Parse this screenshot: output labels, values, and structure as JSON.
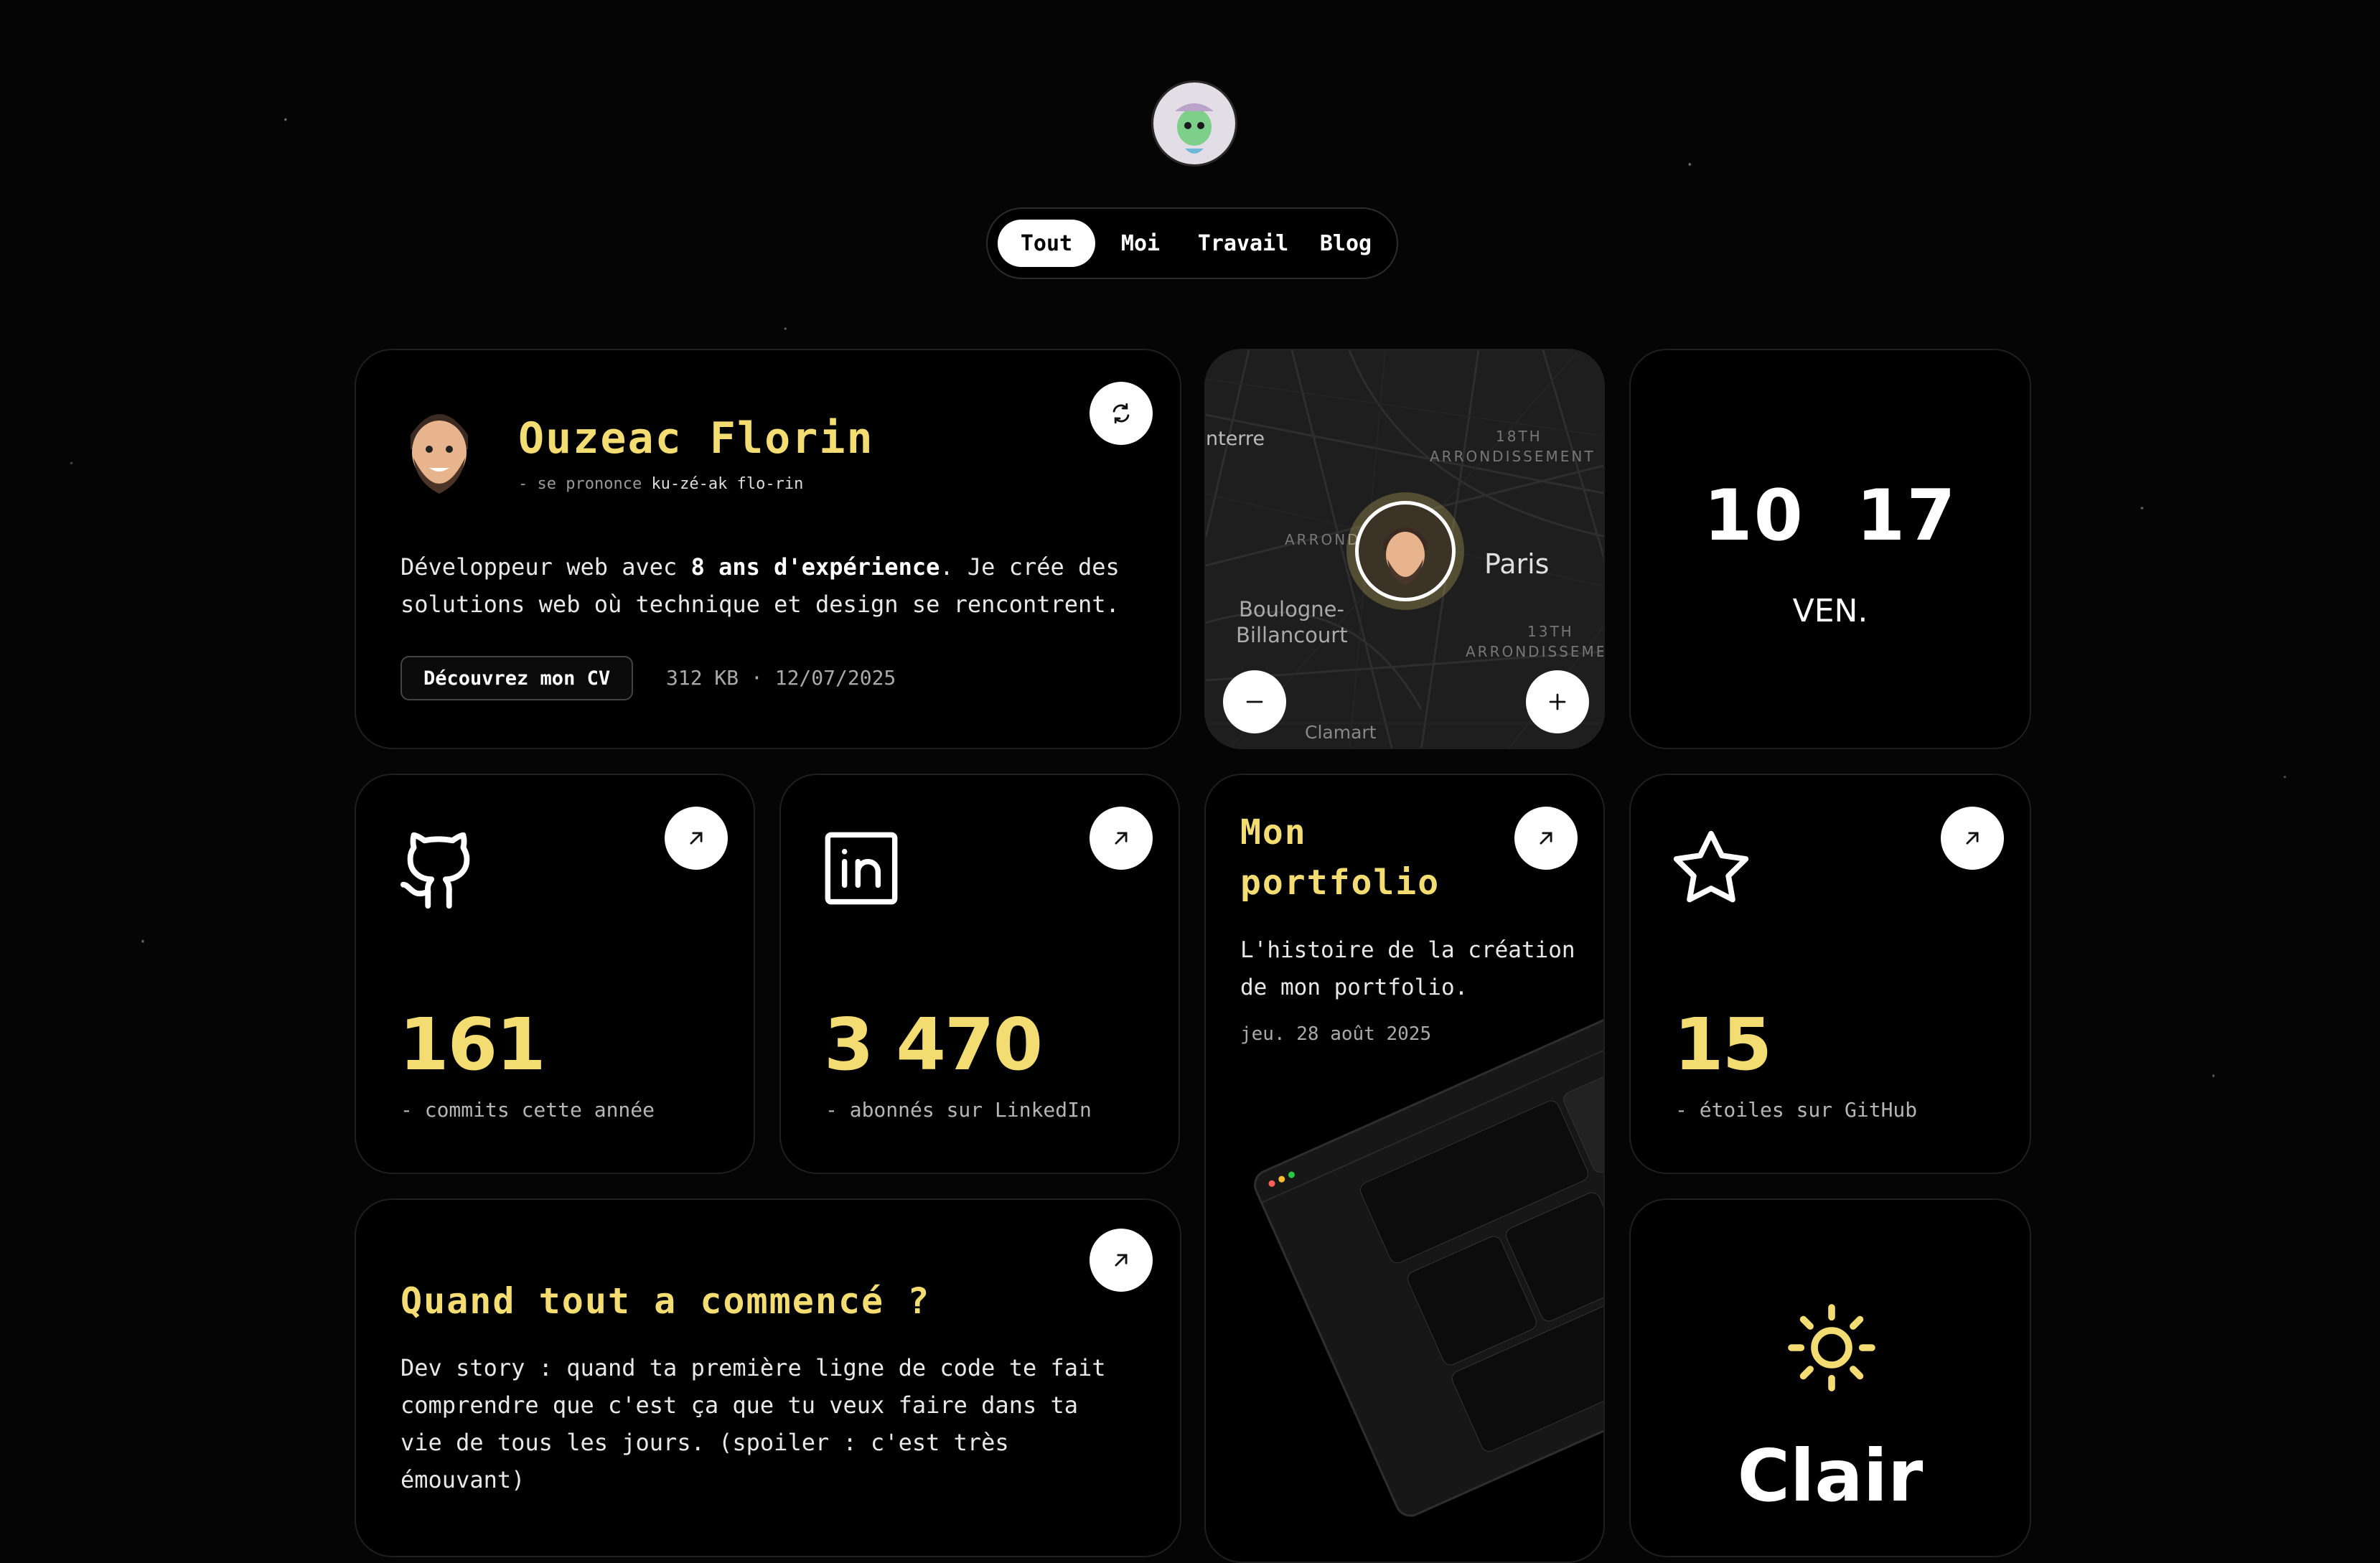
{
  "nav": {
    "tabs": [
      "Tout",
      "Moi",
      "Travail",
      "Blog"
    ],
    "active": "Tout"
  },
  "profile": {
    "name": "Ouzeac Florin",
    "pronounce_prefix": "- se prononce",
    "pronounce": "ku-zé-ak flo-rin",
    "bio_1": "Développeur web avec ",
    "bio_bold": "8 ans d'expérience",
    "bio_2": ". Je crée des solutions web où technique et design se rencontrent.",
    "cv_button": "Découvrez mon CV",
    "cv_meta": "312 KB · 12/07/2025"
  },
  "map": {
    "labels": [
      "nterre",
      "18TH",
      "ARRONDISSEMENT",
      "ARRONDISSEMENT",
      "Paris",
      "Boulogne-",
      "Billancourt",
      "13TH",
      "ARRONDISSEME",
      "Clamart"
    ]
  },
  "clock": {
    "hours": "10",
    "minutes": "17",
    "day": "VEN."
  },
  "github": {
    "value": "161",
    "caption": "- commits cette année"
  },
  "linkedin": {
    "value": "3 470",
    "caption": "- abonnés sur LinkedIn"
  },
  "portfolio": {
    "title_1": "Mon",
    "title_2": "portfolio",
    "text": "L'histoire de la création de mon portfolio.",
    "date": "jeu. 28 août 2025"
  },
  "stars": {
    "value": "15",
    "caption": "- étoiles sur GitHub"
  },
  "story": {
    "title": "Quand tout a commencé ?",
    "text": "Dev story : quand ta première ligne de code te fait comprendre que c'est ça que tu veux faire dans ta vie de tous les jours. (spoiler : c'est très émouvant)"
  },
  "theme": {
    "label": "Clair"
  },
  "colors": {
    "accent": "#f3dc72",
    "background": "#050505",
    "card": "#000000"
  }
}
